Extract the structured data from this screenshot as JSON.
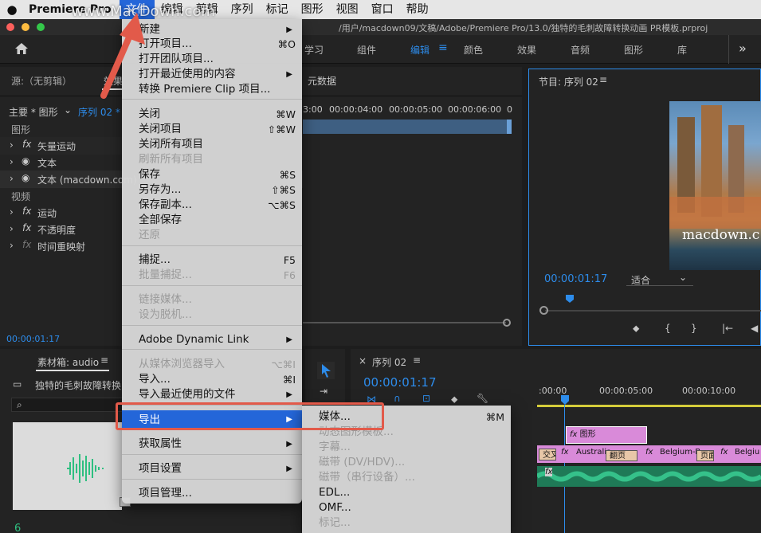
{
  "menubar": {
    "app_name": "Premiere Pro",
    "items": [
      "文件",
      "编辑",
      "剪辑",
      "序列",
      "标记",
      "图形",
      "视图",
      "窗口",
      "帮助"
    ],
    "watermark": "www.MacDown.com"
  },
  "window": {
    "path": "/用户/macdown09/文稿/Adobe/Premiere Pro/13.0/独特的毛刺故障转换动画 PR模板.prproj"
  },
  "workspaces": {
    "items": [
      "学习",
      "组件",
      "编辑",
      "颜色",
      "效果",
      "音频",
      "图形",
      "库"
    ],
    "active": "编辑",
    "more": "»"
  },
  "effect_controls": {
    "tab_source": "源:（无剪辑）",
    "tab_effects": "效果",
    "metadata_tab": "元数据",
    "clip_name": "主要 * 图形",
    "sequence_name": "序列 02 *",
    "section_graphics": "图形",
    "section_video": "视频",
    "rows": [
      "矢量运动",
      "文本",
      "文本 (macdown.com)",
      "运动",
      "不透明度",
      "时间重映射"
    ],
    "timecode": "00:00:01:17",
    "ruler": [
      "3:00",
      "00:00:04:00",
      "00:00:05:00",
      "00:00:06:00",
      "0"
    ]
  },
  "program_monitor": {
    "title": "节目: 序列 02",
    "timecode": "00:00:01:17",
    "fit": "适合",
    "overlay_text": "macdown.c"
  },
  "bin": {
    "title": "素材箱: audio",
    "item": "独特的毛刺故障转换",
    "number": "6"
  },
  "timeline": {
    "title": "序列 02",
    "timecode": "00:00:01:17",
    "ruler": [
      ":00:00",
      "00:00:05:00",
      "00:00:10:00"
    ],
    "clips": [
      "图形",
      "交叉",
      "Australia",
      "翻页",
      "Belgium-B",
      "页面",
      "Belgiu"
    ]
  },
  "file_menu": {
    "items": [
      {
        "label": "新建",
        "shortcut": "",
        "arrow": true,
        "disabled": false
      },
      {
        "label": "打开项目...",
        "shortcut": "⌘O",
        "arrow": false,
        "disabled": false
      },
      {
        "label": "打开团队项目...",
        "shortcut": "",
        "arrow": false,
        "disabled": false
      },
      {
        "label": "打开最近使用的内容",
        "shortcut": "",
        "arrow": true,
        "disabled": false
      },
      {
        "label": "转换 Premiere Clip 项目...",
        "shortcut": "",
        "arrow": false,
        "disabled": false
      },
      {
        "label": "关闭",
        "shortcut": "⌘W",
        "arrow": false,
        "disabled": false
      },
      {
        "label": "关闭项目",
        "shortcut": "⇧⌘W",
        "arrow": false,
        "disabled": false
      },
      {
        "label": "关闭所有项目",
        "shortcut": "",
        "arrow": false,
        "disabled": false
      },
      {
        "label": "刷新所有项目",
        "shortcut": "",
        "arrow": false,
        "disabled": true
      },
      {
        "label": "保存",
        "shortcut": "⌘S",
        "arrow": false,
        "disabled": false
      },
      {
        "label": "另存为...",
        "shortcut": "⇧⌘S",
        "arrow": false,
        "disabled": false
      },
      {
        "label": "保存副本...",
        "shortcut": "⌥⌘S",
        "arrow": false,
        "disabled": false
      },
      {
        "label": "全部保存",
        "shortcut": "",
        "arrow": false,
        "disabled": false
      },
      {
        "label": "还原",
        "shortcut": "",
        "arrow": false,
        "disabled": true
      },
      {
        "label": "捕捉...",
        "shortcut": "F5",
        "arrow": false,
        "disabled": false
      },
      {
        "label": "批量捕捉...",
        "shortcut": "F6",
        "arrow": false,
        "disabled": true
      },
      {
        "label": "链接媒体...",
        "shortcut": "",
        "arrow": false,
        "disabled": true
      },
      {
        "label": "设为脱机...",
        "shortcut": "",
        "arrow": false,
        "disabled": true
      },
      {
        "label": "Adobe Dynamic Link",
        "shortcut": "",
        "arrow": true,
        "disabled": false
      },
      {
        "label": "从媒体浏览器导入",
        "shortcut": "⌥⌘I",
        "arrow": false,
        "disabled": true
      },
      {
        "label": "导入...",
        "shortcut": "⌘I",
        "arrow": false,
        "disabled": false
      },
      {
        "label": "导入最近使用的文件",
        "shortcut": "",
        "arrow": true,
        "disabled": false
      },
      {
        "label": "导出",
        "shortcut": "",
        "arrow": true,
        "disabled": false
      },
      {
        "label": "获取属性",
        "shortcut": "",
        "arrow": true,
        "disabled": false
      },
      {
        "label": "项目设置",
        "shortcut": "",
        "arrow": true,
        "disabled": false
      },
      {
        "label": "项目管理...",
        "shortcut": "",
        "arrow": false,
        "disabled": false
      }
    ]
  },
  "export_submenu": {
    "items": [
      {
        "label": "媒体...",
        "shortcut": "⌘M",
        "disabled": false
      },
      {
        "label": "动态图形模板...",
        "shortcut": "",
        "disabled": true
      },
      {
        "label": "字幕...",
        "shortcut": "",
        "disabled": true
      },
      {
        "label": "磁带 (DV/HDV)...",
        "shortcut": "",
        "disabled": true
      },
      {
        "label": "磁带（串行设备）...",
        "shortcut": "",
        "disabled": true
      },
      {
        "label": "EDL...",
        "shortcut": "",
        "disabled": false
      },
      {
        "label": "OMF...",
        "shortcut": "",
        "disabled": false
      },
      {
        "label": "标记...",
        "shortcut": "",
        "disabled": true
      }
    ]
  },
  "colors": {
    "accent": "#2466d9",
    "highlight_box": "#e25a4a",
    "timeline_blue": "#2d8ceb",
    "clip_pink": "#d98ad9",
    "audio_green": "#2fbf80"
  }
}
